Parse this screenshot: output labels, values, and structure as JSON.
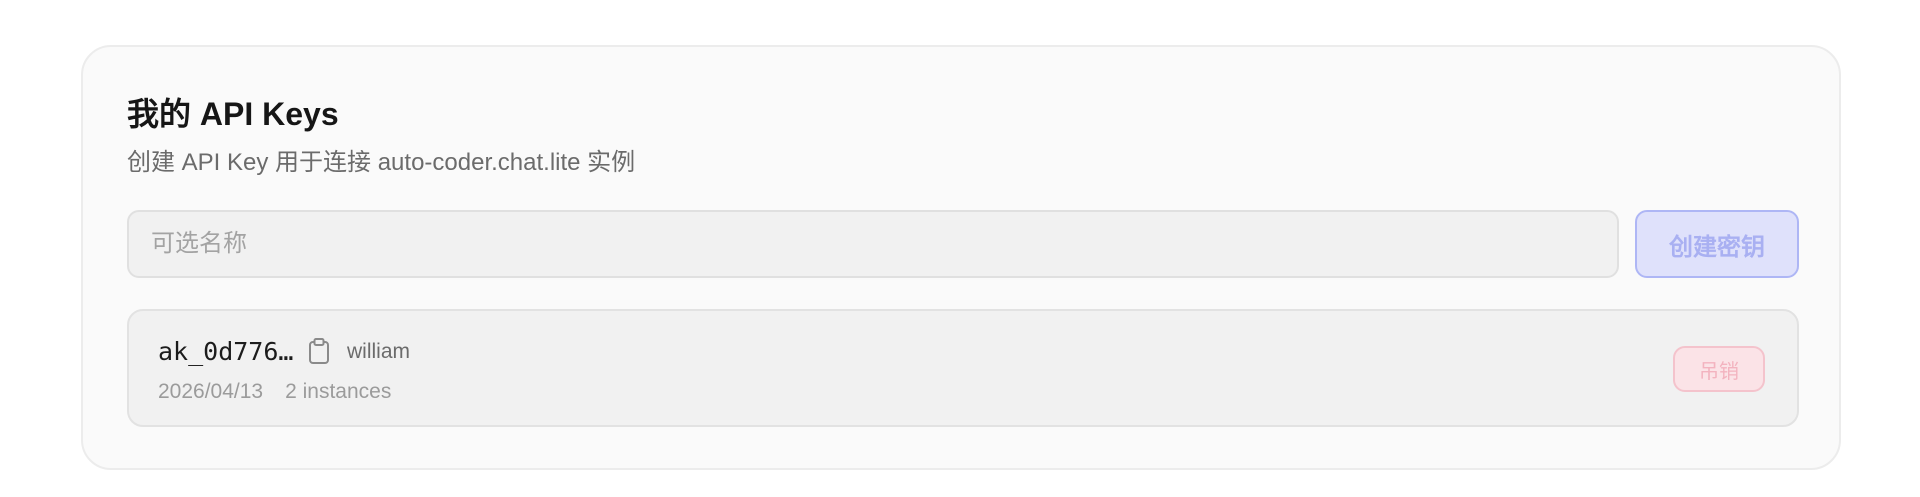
{
  "card": {
    "title": "我的 API Keys",
    "subtitle": "创建 API Key 用于连接 auto-coder.chat.lite 实例"
  },
  "form": {
    "name_placeholder": "可选名称",
    "name_value": "",
    "create_label": "创建密钥"
  },
  "keys": [
    {
      "id": "ak_0d776…",
      "owner": "william",
      "date": "2026/04/13",
      "instances": "2 instances",
      "revoke_label": "吊销"
    }
  ],
  "icons": {
    "copy": "clipboard-icon"
  },
  "colors": {
    "primary_disabled_bg": "#dfe1fb",
    "primary_disabled_text": "#a9b0f2",
    "danger_disabled_bg": "#fbe3e7",
    "danger_disabled_text": "#f3b3bf"
  }
}
